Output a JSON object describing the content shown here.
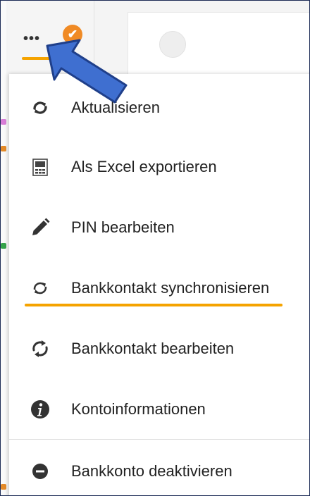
{
  "toolbar": {
    "more_label": "•••",
    "check_icon": "✔"
  },
  "menu": {
    "items": [
      {
        "label": "Aktualisieren",
        "icon": "refresh-icon"
      },
      {
        "label": "Als Excel exportieren",
        "icon": "excel-icon"
      },
      {
        "label": "PIN bearbeiten",
        "icon": "pencil-icon"
      },
      {
        "label": "Bankkontakt synchronisieren",
        "icon": "sync-icon"
      },
      {
        "label": "Bankkontakt bearbeiten",
        "icon": "arrows-sync-icon"
      },
      {
        "label": "Kontoinformationen",
        "icon": "info-icon"
      },
      {
        "label": "Bankkonto deaktivieren",
        "icon": "minus-circle-icon"
      }
    ]
  },
  "colors": {
    "accent": "#f5a300",
    "badge": "#f08a24",
    "arrow": "#3f6fd0"
  }
}
